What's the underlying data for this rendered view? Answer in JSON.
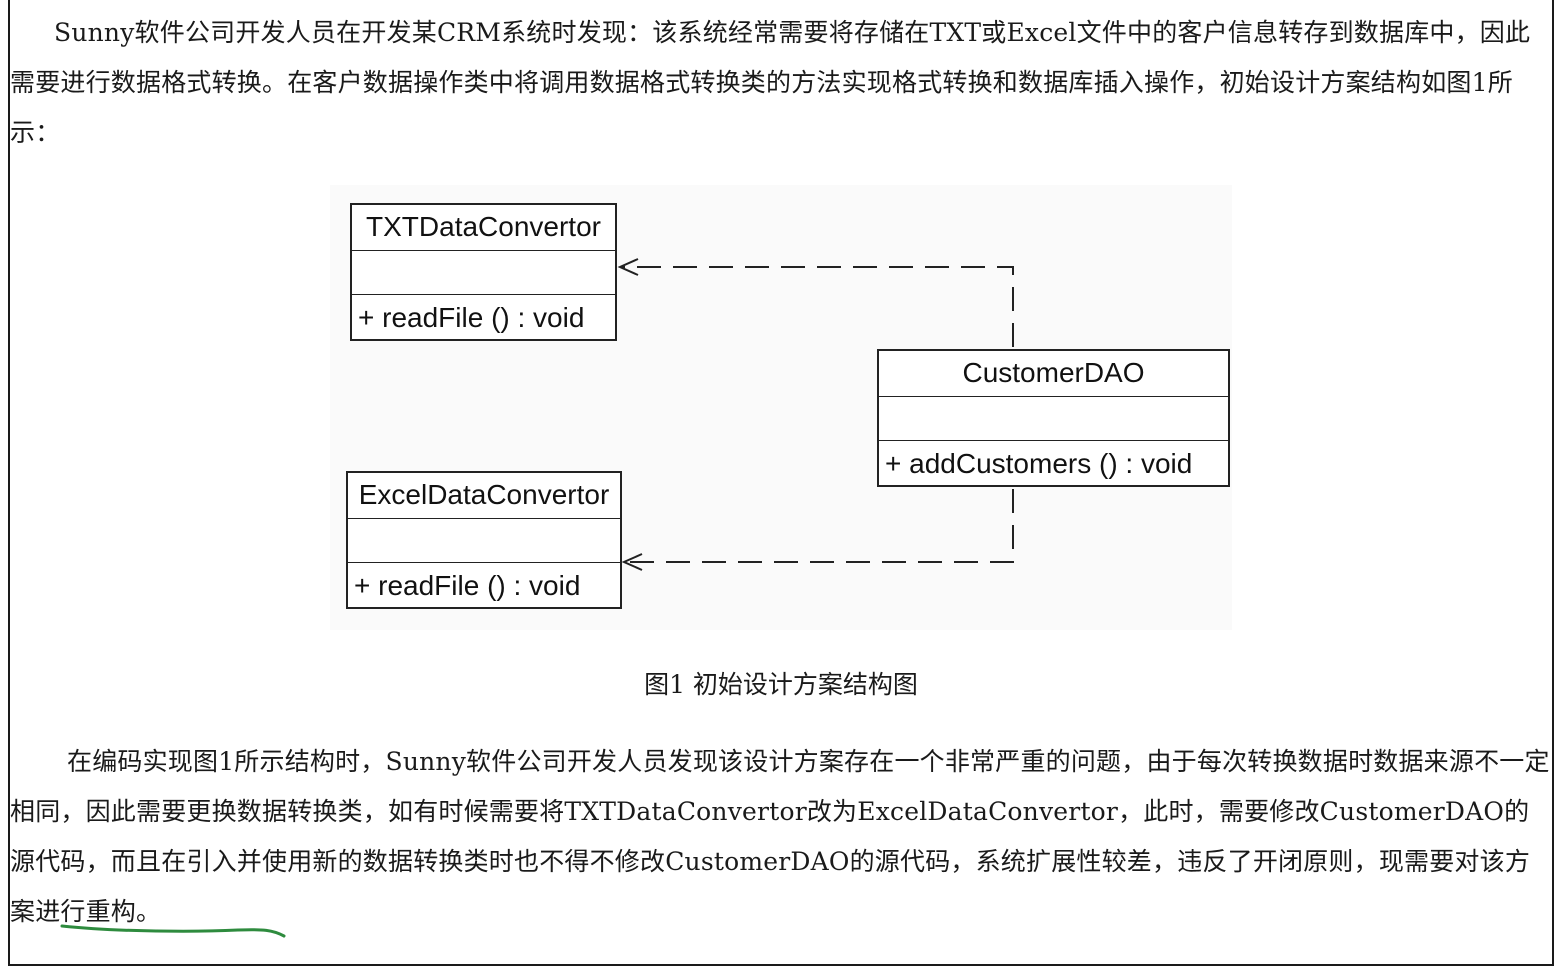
{
  "paragraphs": {
    "p1": "Sunny软件公司开发人员在开发某CRM系统时发现：该系统经常需要将存储在TXT或Excel文件中的客户信息转存到数据库中，因此需要进行数据格式转换。在客户数据操作类中将调用数据格式转换类的方法实现格式转换和数据库插入操作，初始设计方案结构如图1所示：",
    "p2_before": "在编码实现图1所示结构时，Sunny软件公司开发人员发现该设计方案存在一个非常严重的问题，由于每次转换数据时数据来源不一定相同，因此需要更换数据转换类，如有时候需要将TXTDataConvertor改为ExcelDataConvertor，此时，需要修改CustomerDAO的源代码，而且在引入并使用新的数据转换类时也不得不修改CustomerDAO的源代码，系统扩展性较差，",
    "p2_highlight": "违反了开闭原则，",
    "p2_after": "现需要对该方案进行重构。"
  },
  "figure": {
    "caption": "图1 初始设计方案结构图",
    "classes": {
      "txt": {
        "name": "TXTDataConvertor",
        "operation": "+  readFile () : void"
      },
      "excel": {
        "name": "ExcelDataConvertor",
        "operation": "+  readFile () : void"
      },
      "customer": {
        "name": "CustomerDAO",
        "operation": "+  addCustomers () : void"
      }
    }
  },
  "colors": {
    "text": "#1a1a1a",
    "annotation_underline": "#2e8b3e"
  }
}
